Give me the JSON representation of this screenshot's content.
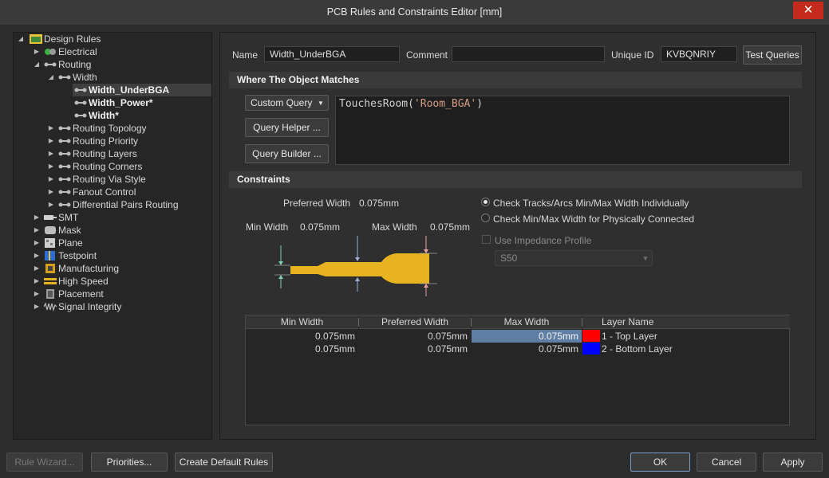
{
  "window": {
    "title": "PCB Rules and Constraints Editor [mm]",
    "close_glyph": "✕"
  },
  "tree": {
    "root": "Design Rules",
    "electrical": "Electrical",
    "routing": "Routing",
    "width": "Width",
    "width_underbga": "Width_UnderBGA",
    "width_power": "Width_Power*",
    "width_star": "Width*",
    "routing_topology": "Routing Topology",
    "routing_priority": "Routing Priority",
    "routing_layers": "Routing Layers",
    "routing_corners": "Routing Corners",
    "routing_via_style": "Routing Via Style",
    "fanout_control": "Fanout Control",
    "diff_pairs_routing": "Differential Pairs Routing",
    "smt": "SMT",
    "mask": "Mask",
    "plane": "Plane",
    "testpoint": "Testpoint",
    "manufacturing": "Manufacturing",
    "high_speed": "High Speed",
    "placement": "Placement",
    "signal_integrity": "Signal Integrity"
  },
  "rule": {
    "name_label": "Name",
    "name_value": "Width_UnderBGA",
    "comment_label": "Comment",
    "comment_value": "",
    "uid_label": "Unique ID",
    "uid_value": "KVBQNRIY",
    "test_queries": "Test Queries"
  },
  "where_matches": {
    "header": "Where The Object Matches",
    "query_type": "Custom Query",
    "query_helper": "Query Helper ...",
    "query_builder": "Query Builder ...",
    "query_fn": "TouchesRoom(",
    "query_arg": "'Room_BGA'",
    "query_close": ")"
  },
  "constraints": {
    "header": "Constraints",
    "preferred_width_label": "Preferred Width",
    "preferred_width_value": "0.075mm",
    "min_width_label": "Min Width",
    "min_width_value": "0.075mm",
    "max_width_label": "Max Width",
    "max_width_value": "0.075mm",
    "radio_individually": "Check Tracks/Arcs Min/Max Width Individually",
    "radio_physically": "Check Min/Max Width for Physically Connected",
    "use_impedance": "Use Impedance Profile",
    "impedance_value": "S50",
    "track_color": "#e8b320"
  },
  "grid": {
    "headers": [
      "Min Width",
      "Preferred Width",
      "Max Width",
      "Layer Name"
    ],
    "rows": [
      {
        "min": "0.075mm",
        "pref": "0.075mm",
        "max": "0.075mm",
        "layer": "1 - Top Layer",
        "color": "#ff0000"
      },
      {
        "min": "0.075mm",
        "pref": "0.075mm",
        "max": "0.075mm",
        "layer": "2 - Bottom Layer",
        "color": "#0000ff"
      }
    ]
  },
  "footer": {
    "rule_wizard": "Rule Wizard...",
    "priorities": "Priorities...",
    "create_default": "Create Default Rules",
    "ok": "OK",
    "cancel": "Cancel",
    "apply": "Apply"
  }
}
